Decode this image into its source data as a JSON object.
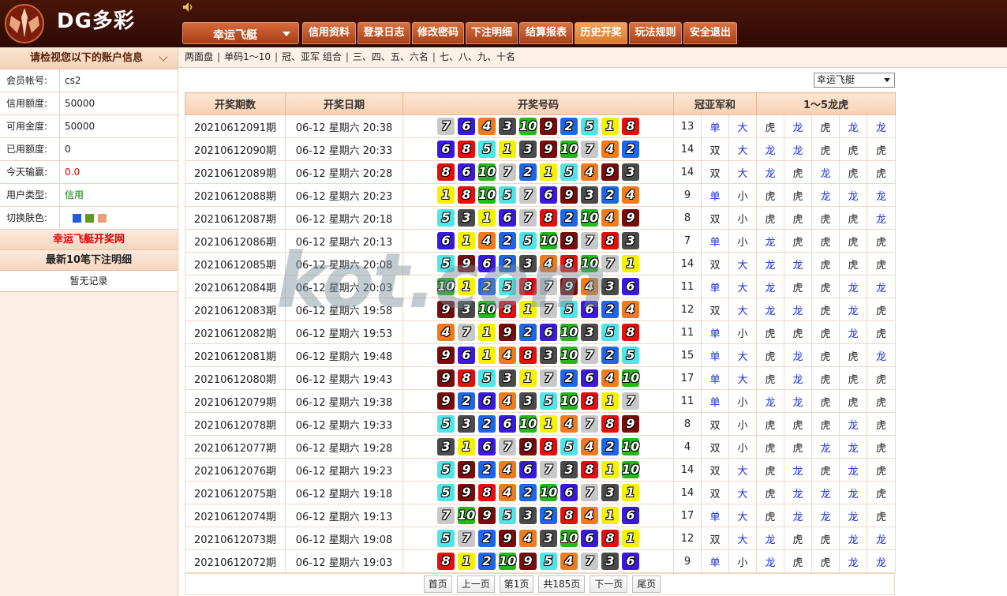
{
  "header": {
    "logo_text": "DG多彩",
    "game_select": "幸运飞艇"
  },
  "nav": [
    "信用资料",
    "登录日志",
    "修改密码",
    "下注明细",
    "结算报表",
    "历史开奖",
    "玩法规则",
    "安全退出"
  ],
  "sidebar": {
    "title": "请检视您以下的账户信息",
    "rows": [
      {
        "label": "会员帐号:",
        "value": "cs2",
        "color": "#222"
      },
      {
        "label": "信用额度:",
        "value": "50000",
        "color": "#222"
      },
      {
        "label": "可用金度:",
        "value": "50000",
        "color": "#222"
      },
      {
        "label": "已用额度:",
        "value": "0",
        "color": "#222"
      },
      {
        "label": "今天输赢:",
        "value": "0.0",
        "color": "#e00000"
      },
      {
        "label": "用户类型:",
        "value": "信用",
        "color": "#0a7a0a"
      }
    ],
    "skin_label": "切换肤色:",
    "skins": [
      "#1d5fdc",
      "#5a9c1c",
      "#e8a07a"
    ],
    "site_link": "幸运飞艇开奖网",
    "recent_title": "最新10笔下注明细",
    "no_record": "暂无记录"
  },
  "subnav": [
    "两面盘",
    "单码1～10",
    "冠、亚军 组合",
    "三、四、五、六名",
    "七、八、九、十名"
  ],
  "lottery_select": "幸运飞艇",
  "table": {
    "headers": [
      "开奖期数",
      "开奖日期",
      "开奖号码",
      "冠亚军和",
      "1～5龙虎"
    ],
    "rows": [
      {
        "issue": "20210612091期",
        "date": "06-12 星期六 20:38",
        "nums": [
          7,
          6,
          4,
          3,
          10,
          9,
          2,
          5,
          1,
          8
        ],
        "sum": "13",
        "oe": "单",
        "bs": "大",
        "lh": [
          "虎",
          "龙",
          "虎",
          "龙",
          "龙"
        ]
      },
      {
        "issue": "20210612090期",
        "date": "06-12 星期六 20:33",
        "nums": [
          6,
          8,
          5,
          1,
          3,
          9,
          10,
          7,
          4,
          2
        ],
        "sum": "14",
        "oe": "双",
        "bs": "大",
        "lh": [
          "龙",
          "龙",
          "虎",
          "虎",
          "虎"
        ]
      },
      {
        "issue": "20210612089期",
        "date": "06-12 星期六 20:28",
        "nums": [
          8,
          6,
          10,
          7,
          2,
          1,
          5,
          4,
          9,
          3
        ],
        "sum": "14",
        "oe": "双",
        "bs": "大",
        "lh": [
          "龙",
          "虎",
          "龙",
          "虎",
          "虎"
        ]
      },
      {
        "issue": "20210612088期",
        "date": "06-12 星期六 20:23",
        "nums": [
          1,
          8,
          10,
          5,
          7,
          6,
          9,
          3,
          2,
          4
        ],
        "sum": "9",
        "oe": "单",
        "bs": "小",
        "lh": [
          "虎",
          "虎",
          "龙",
          "龙",
          "龙"
        ]
      },
      {
        "issue": "20210612087期",
        "date": "06-12 星期六 20:18",
        "nums": [
          5,
          3,
          1,
          6,
          7,
          8,
          2,
          10,
          4,
          9
        ],
        "sum": "8",
        "oe": "双",
        "bs": "小",
        "lh": [
          "虎",
          "虎",
          "虎",
          "虎",
          "龙"
        ]
      },
      {
        "issue": "20210612086期",
        "date": "06-12 星期六 20:13",
        "nums": [
          6,
          1,
          4,
          2,
          5,
          10,
          9,
          7,
          8,
          3
        ],
        "sum": "7",
        "oe": "单",
        "bs": "小",
        "lh": [
          "龙",
          "虎",
          "虎",
          "虎",
          "虎"
        ]
      },
      {
        "issue": "20210612085期",
        "date": "06-12 星期六 20:08",
        "nums": [
          5,
          9,
          6,
          2,
          3,
          4,
          8,
          10,
          7,
          1
        ],
        "sum": "14",
        "oe": "双",
        "bs": "大",
        "lh": [
          "龙",
          "龙",
          "虎",
          "虎",
          "虎"
        ]
      },
      {
        "issue": "20210612084期",
        "date": "06-12 星期六 20:03",
        "nums": [
          10,
          1,
          2,
          5,
          8,
          7,
          9,
          4,
          3,
          6
        ],
        "sum": "11",
        "oe": "单",
        "bs": "大",
        "lh": [
          "龙",
          "虎",
          "虎",
          "龙",
          "龙"
        ]
      },
      {
        "issue": "20210612083期",
        "date": "06-12 星期六 19:58",
        "nums": [
          9,
          3,
          10,
          8,
          1,
          7,
          5,
          6,
          2,
          4
        ],
        "sum": "12",
        "oe": "双",
        "bs": "大",
        "lh": [
          "龙",
          "龙",
          "虎",
          "龙",
          "虎"
        ]
      },
      {
        "issue": "20210612082期",
        "date": "06-12 星期六 19:53",
        "nums": [
          4,
          7,
          1,
          9,
          2,
          6,
          10,
          3,
          5,
          8
        ],
        "sum": "11",
        "oe": "单",
        "bs": "小",
        "lh": [
          "虎",
          "虎",
          "虎",
          "龙",
          "虎"
        ]
      },
      {
        "issue": "20210612081期",
        "date": "06-12 星期六 19:48",
        "nums": [
          9,
          6,
          1,
          4,
          8,
          3,
          10,
          7,
          2,
          5
        ],
        "sum": "15",
        "oe": "单",
        "bs": "大",
        "lh": [
          "虎",
          "龙",
          "虎",
          "虎",
          "龙"
        ]
      },
      {
        "issue": "20210612080期",
        "date": "06-12 星期六 19:43",
        "nums": [
          9,
          8,
          5,
          3,
          1,
          7,
          2,
          6,
          4,
          10
        ],
        "sum": "17",
        "oe": "单",
        "bs": "大",
        "lh": [
          "虎",
          "龙",
          "虎",
          "虎",
          "虎"
        ]
      },
      {
        "issue": "20210612079期",
        "date": "06-12 星期六 19:38",
        "nums": [
          9,
          2,
          6,
          4,
          3,
          5,
          10,
          8,
          1,
          7
        ],
        "sum": "11",
        "oe": "单",
        "bs": "小",
        "lh": [
          "龙",
          "龙",
          "虎",
          "虎",
          "虎"
        ]
      },
      {
        "issue": "20210612078期",
        "date": "06-12 星期六 19:33",
        "nums": [
          5,
          3,
          2,
          6,
          10,
          1,
          4,
          7,
          8,
          9
        ],
        "sum": "8",
        "oe": "双",
        "bs": "小",
        "lh": [
          "虎",
          "虎",
          "虎",
          "龙",
          "虎"
        ]
      },
      {
        "issue": "20210612077期",
        "date": "06-12 星期六 19:28",
        "nums": [
          3,
          1,
          6,
          7,
          9,
          8,
          5,
          4,
          2,
          10
        ],
        "sum": "4",
        "oe": "双",
        "bs": "小",
        "lh": [
          "虎",
          "虎",
          "龙",
          "龙",
          "虎"
        ]
      },
      {
        "issue": "20210612076期",
        "date": "06-12 星期六 19:23",
        "nums": [
          5,
          9,
          2,
          4,
          6,
          7,
          3,
          8,
          1,
          10
        ],
        "sum": "14",
        "oe": "双",
        "bs": "大",
        "lh": [
          "虎",
          "龙",
          "虎",
          "龙",
          "虎"
        ]
      },
      {
        "issue": "20210612075期",
        "date": "06-12 星期六 19:18",
        "nums": [
          5,
          9,
          8,
          4,
          2,
          10,
          6,
          7,
          3,
          1
        ],
        "sum": "14",
        "oe": "双",
        "bs": "大",
        "lh": [
          "虎",
          "龙",
          "龙",
          "龙",
          "虎"
        ]
      },
      {
        "issue": "20210612074期",
        "date": "06-12 星期六 19:13",
        "nums": [
          7,
          10,
          9,
          5,
          3,
          2,
          8,
          4,
          1,
          6
        ],
        "sum": "17",
        "oe": "单",
        "bs": "大",
        "lh": [
          "虎",
          "龙",
          "龙",
          "龙",
          "虎"
        ]
      },
      {
        "issue": "20210612073期",
        "date": "06-12 星期六 19:08",
        "nums": [
          5,
          7,
          2,
          9,
          4,
          3,
          10,
          6,
          8,
          1
        ],
        "sum": "12",
        "oe": "双",
        "bs": "大",
        "lh": [
          "龙",
          "虎",
          "虎",
          "龙",
          "龙"
        ]
      },
      {
        "issue": "20210612072期",
        "date": "06-12 星期六 19:03",
        "nums": [
          8,
          1,
          2,
          10,
          9,
          5,
          4,
          7,
          3,
          6
        ],
        "sum": "9",
        "oe": "单",
        "bs": "小",
        "lh": [
          "龙",
          "虎",
          "虎",
          "龙",
          "龙"
        ]
      }
    ]
  },
  "pager": [
    "首页",
    "上一页",
    "第1页",
    "共185页",
    "下一页",
    "尾页"
  ],
  "watermark": "kot.com"
}
